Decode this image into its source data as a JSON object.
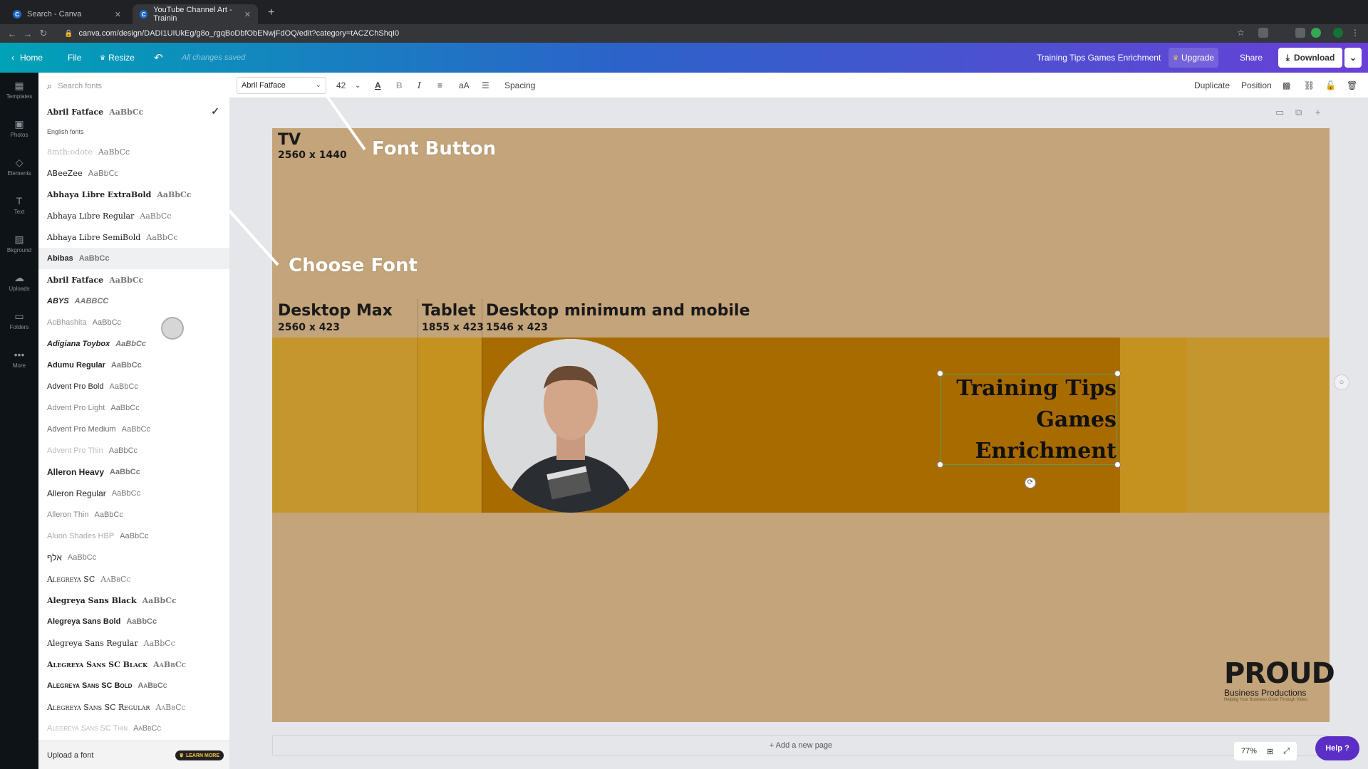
{
  "browser": {
    "tabs": [
      {
        "label": "Search - Canva",
        "close": "✕"
      },
      {
        "label": "YouTube Channel Art - Trainin",
        "close": "✕"
      }
    ],
    "new_tab": "+",
    "url": "canva.com/design/DADI1UIUkEg/g8o_rgqBoDbfObENwjFdOQ/edit?category=tACZChShqI0"
  },
  "header": {
    "home": "Home",
    "file": "File",
    "resize": "Resize",
    "status": "All changes saved",
    "doc_title": "Training Tips Games Enrichment",
    "upgrade": "Upgrade",
    "share": "Share",
    "download": "Download"
  },
  "rail": [
    {
      "label": "Templates",
      "icon": "templates-icon"
    },
    {
      "label": "Photos",
      "icon": "photos-icon"
    },
    {
      "label": "Elements",
      "icon": "elements-icon"
    },
    {
      "label": "Text",
      "icon": "text-icon"
    },
    {
      "label": "Bkground",
      "icon": "background-icon"
    },
    {
      "label": "Uploads",
      "icon": "uploads-icon"
    },
    {
      "label": "Folders",
      "icon": "folders-icon"
    },
    {
      "label": "More",
      "icon": "more-icon"
    }
  ],
  "font_panel": {
    "search_placeholder": "Search fonts",
    "selected": {
      "name": "Abril Fatface",
      "sample": "AaBbCc"
    },
    "section": "English fonts",
    "fonts": [
      {
        "name": "8mth:odote",
        "sample": "AaBbCc"
      },
      {
        "name": "ABeeZee",
        "sample": "AaBbCc"
      },
      {
        "name": "Abhaya Libre ExtraBold",
        "sample": "AaBbCc"
      },
      {
        "name": "Abhaya Libre Regular",
        "sample": "AaBbCc"
      },
      {
        "name": "Abhaya Libre SemiBold",
        "sample": "AaBbCc"
      },
      {
        "name": "Abibas",
        "sample": "AaBbCc"
      },
      {
        "name": "Abril Fatface",
        "sample": "AaBbCc"
      },
      {
        "name": "ABYS",
        "sample": "AABBCC"
      },
      {
        "name": "AcBhashita",
        "sample": "AaBbCc"
      },
      {
        "name": "Adigiana Toybox",
        "sample": "AaBbCc"
      },
      {
        "name": "Adumu Regular",
        "sample": "AaBbCc"
      },
      {
        "name": "Advent Pro Bold",
        "sample": "AaBbCc"
      },
      {
        "name": "Advent Pro Light",
        "sample": "AaBbCc"
      },
      {
        "name": "Advent Pro Medium",
        "sample": "AaBbCc"
      },
      {
        "name": "Advent Pro Thin",
        "sample": "AaBbCc"
      },
      {
        "name": "Alleron Heavy",
        "sample": "AaBbCc"
      },
      {
        "name": "Alleron Regular",
        "sample": "AaBbCc"
      },
      {
        "name": "Alleron Thin",
        "sample": "AaBbCc"
      },
      {
        "name": "Aluon Shades HBP",
        "sample": "AaBbCc"
      },
      {
        "name": "אלף",
        "sample": "AaBbCc"
      },
      {
        "name": "Alegreya SC",
        "sample": "AaBbCc"
      },
      {
        "name": "Alegreya Sans Black",
        "sample": "AaBbCc"
      },
      {
        "name": "Alegreya Sans Bold",
        "sample": "AaBbCc"
      },
      {
        "name": "Alegreya Sans Regular",
        "sample": "AaBbCc"
      },
      {
        "name": "Alegreya Sans SC Black",
        "sample": "AaBbCc"
      },
      {
        "name": "Alegreya Sans SC Bold",
        "sample": "AaBbCc"
      },
      {
        "name": "Alegreya Sans SC Regular",
        "sample": "AaBbCc"
      },
      {
        "name": "Alegreya Sans SC Thin",
        "sample": "AaBbCc"
      }
    ],
    "upload": "Upload a font",
    "learn_more": "LEARN MORE"
  },
  "toolbar": {
    "font": "Abril Fatface",
    "size": "42",
    "spacing": "Spacing",
    "duplicate": "Duplicate",
    "position": "Position"
  },
  "canvas": {
    "tv_title": "TV",
    "tv_dims": "2560 x 1440",
    "desktop_max": "Desktop Max",
    "desktop_max_dims": "2560 x 423",
    "tablet": "Tablet",
    "tablet_dims": "1855 x 423",
    "desktop_min": "Desktop minimum and mobile",
    "desktop_min_dims": "1546 x 423",
    "title_lines": [
      "Training Tips",
      "Games",
      "Enrichment"
    ],
    "logo": {
      "main": "PROUD",
      "sub": "Business Productions",
      "tag": "Helping Your Business Grow Through Video"
    }
  },
  "footer": {
    "add_page": "+ Add a new page",
    "zoom": "77%",
    "help": "Help ?"
  },
  "annotations": {
    "font_button": "Font Button",
    "choose_font": "Choose Font"
  }
}
